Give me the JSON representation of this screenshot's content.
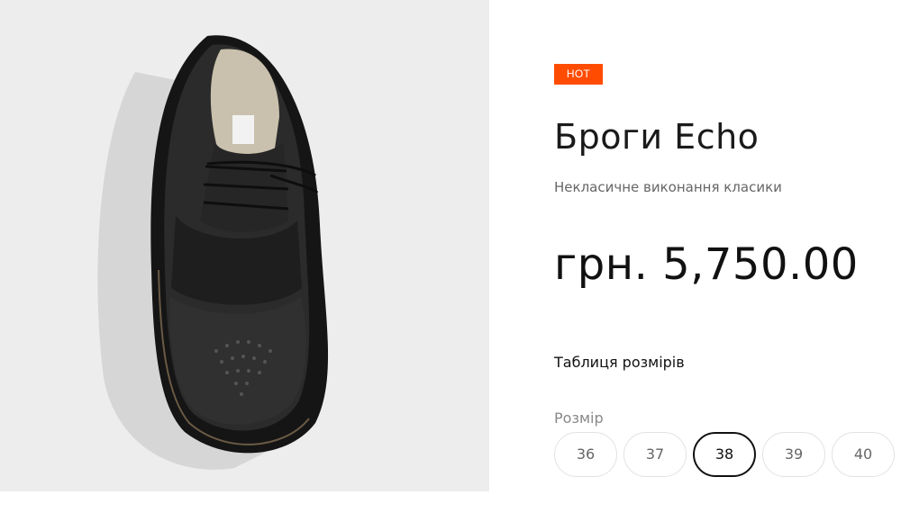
{
  "product": {
    "badge": "HOT",
    "title": "Броги Echo",
    "subtitle": "Некласичне виконання класики",
    "price": "грн. 5,750.00",
    "size_chart_link": "Таблиця розмірів",
    "size_label": "Розмір",
    "sizes": [
      "36",
      "37",
      "38",
      "39",
      "40"
    ],
    "selected_size": "38",
    "badge_color": "#ff4c00"
  }
}
